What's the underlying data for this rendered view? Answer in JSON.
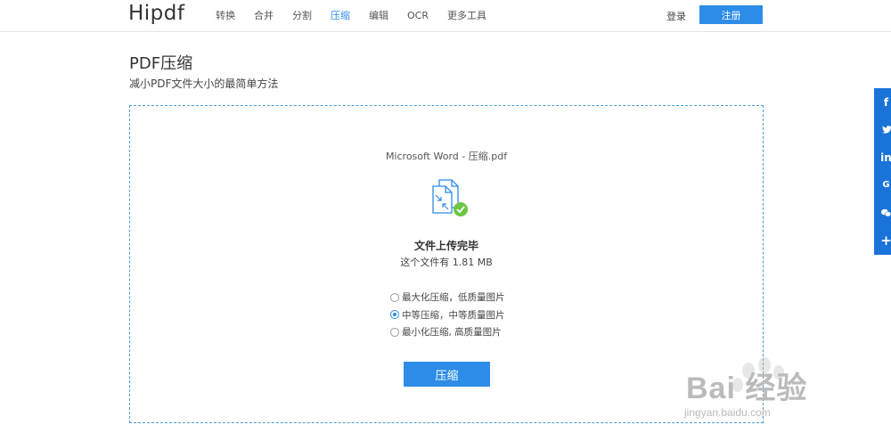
{
  "header": {
    "logo": "Hipdf",
    "nav": [
      {
        "label": "转换"
      },
      {
        "label": "合并"
      },
      {
        "label": "分割"
      },
      {
        "label": "压缩"
      },
      {
        "label": "编辑"
      },
      {
        "label": "OCR"
      },
      {
        "label": "更多工具"
      }
    ],
    "active_nav": "压缩",
    "login": "登录",
    "register": "注册"
  },
  "page": {
    "title": "PDF压缩",
    "subtitle": "减小PDF文件大小的最简单方法"
  },
  "upload": {
    "file_name": "Microsoft Word - 压缩.pdf",
    "status": "文件上传完毕",
    "size_text": "这个文件有 1.81 MB",
    "options": [
      {
        "label": "最大化压缩，低质量图片",
        "checked": false
      },
      {
        "label": "中等压缩，中等质量图片",
        "checked": true
      },
      {
        "label": "最小化压缩, 高质量图片",
        "checked": false
      }
    ],
    "compress_button": "压缩"
  },
  "social": {
    "items": [
      {
        "icon": "facebook-icon",
        "glyph": "f"
      },
      {
        "icon": "twitter-icon",
        "glyph": "🐦"
      },
      {
        "icon": "linkedin-icon",
        "glyph": "in"
      },
      {
        "icon": "google-icon",
        "glyph": "G"
      },
      {
        "icon": "wechat-icon",
        "glyph": "✉"
      },
      {
        "icon": "plus-icon",
        "glyph": "+"
      }
    ]
  },
  "watermark": {
    "text": "Bai  经验",
    "url": "jingyan.baidu.com"
  },
  "colors": {
    "accent": "#2d8ce8",
    "success": "#6cc644",
    "social_bg": "#1a73d8"
  }
}
